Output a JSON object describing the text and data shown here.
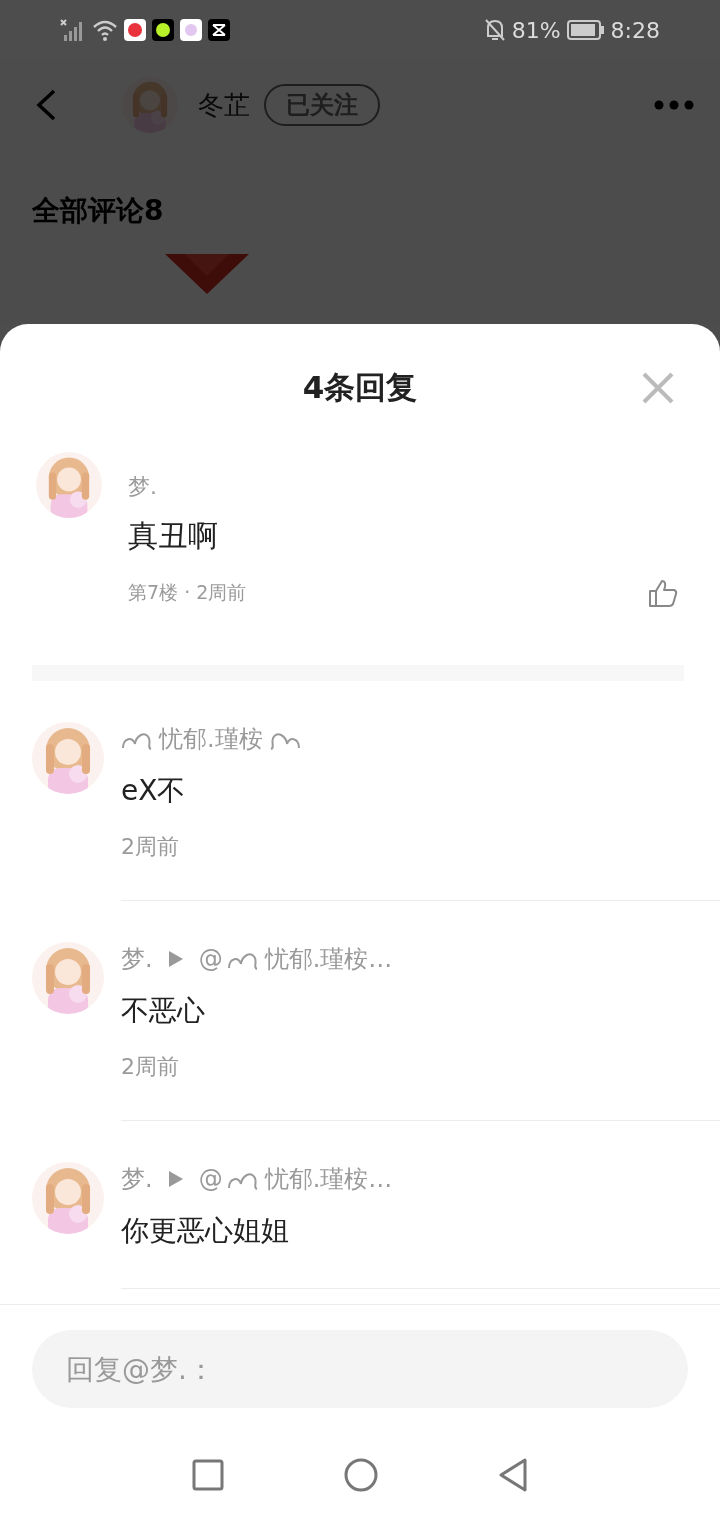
{
  "status_bar": {
    "battery": "81%",
    "time": "8:28"
  },
  "header": {
    "username": "冬芷",
    "follow_button": "已关注"
  },
  "section_title": "全部评论8",
  "sheet": {
    "title": "4条回复",
    "main_comment": {
      "name": "梦.",
      "text": "真丑啊",
      "meta": "第7楼 · 2周前"
    },
    "replies": [
      {
        "name": "忧郁.瑾桉",
        "decorated": true,
        "text": "eX不",
        "time": "2周前"
      },
      {
        "name": "梦.",
        "decorated": false,
        "reply_to": {
          "at": "@",
          "name": "忧郁.瑾桉…"
        },
        "text": "不恶心",
        "time": "2周前"
      },
      {
        "name": "梦.",
        "decorated": false,
        "reply_to": {
          "at": "@",
          "name": "忧郁.瑾桉…"
        },
        "text": "你更恶心姐姐"
      }
    ],
    "reply_field": {
      "placeholder": "回复@梦.："
    }
  }
}
